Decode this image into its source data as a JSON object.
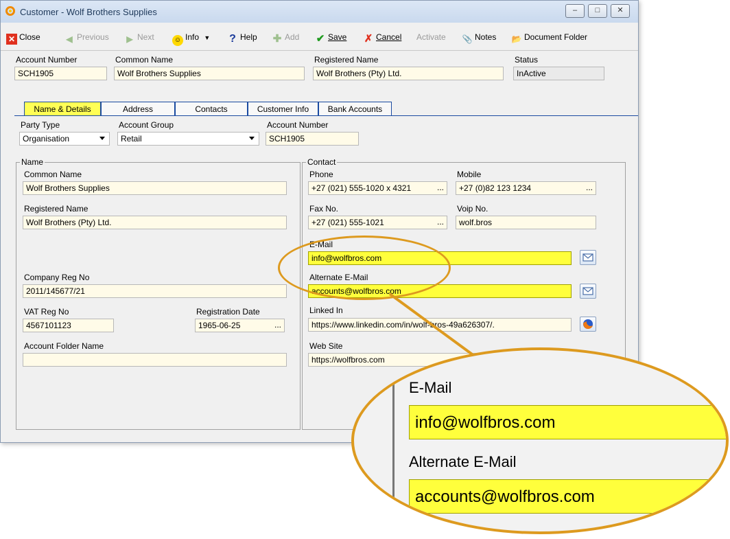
{
  "window": {
    "title": "Customer - Wolf Brothers Supplies",
    "controls": [
      "minimize",
      "maximize",
      "close"
    ]
  },
  "toolbar": {
    "close": "Close",
    "previous": "Previous",
    "next": "Next",
    "info": "Info",
    "help": "Help",
    "add": "Add",
    "save": "Save",
    "cancel": "Cancel",
    "activate": "Activate",
    "notes": "Notes",
    "document_folder": "Document Folder"
  },
  "header": {
    "account_number_label": "Account Number",
    "account_number": "SCH1905",
    "common_name_label": "Common Name",
    "common_name": "Wolf Brothers Supplies",
    "registered_name_label": "Registered Name",
    "registered_name": "Wolf Brothers (Pty) Ltd.",
    "status_label": "Status",
    "status": "InActive"
  },
  "tabs": [
    {
      "label": "Name & Details",
      "active": true
    },
    {
      "label": "Address",
      "active": false
    },
    {
      "label": "Contacts",
      "active": false
    },
    {
      "label": "Customer Info",
      "active": false
    },
    {
      "label": "Bank Accounts",
      "active": false
    }
  ],
  "details": {
    "party_type_label": "Party Type",
    "party_type": "Organisation",
    "account_group_label": "Account Group",
    "account_group": "Retail",
    "account_number_label": "Account Number",
    "account_number": "SCH1905"
  },
  "name_group": {
    "title": "Name",
    "common_name_label": "Common Name",
    "common_name": "Wolf Brothers Supplies",
    "registered_name_label": "Registered Name",
    "registered_name": "Wolf Brothers (Pty) Ltd.",
    "company_reg_label": "Company Reg No",
    "company_reg": "2011/145677/21",
    "vat_label": "VAT Reg No",
    "vat": "4567101123",
    "reg_date_label": "Registration Date",
    "reg_date": "1965-06-25",
    "folder_label": "Account Folder Name",
    "folder": ""
  },
  "contact_group": {
    "title": "Contact",
    "phone_label": "Phone",
    "phone": "+27 (021) 555-1020 x 4321",
    "mobile_label": "Mobile",
    "mobile": "+27 (0)82 123 1234",
    "fax_label": "Fax No.",
    "fax": "+27 (021) 555-1021",
    "voip_label": "Voip No.",
    "voip": "wolf.bros",
    "email_label": "E-Mail",
    "email": "info@wolfbros.com",
    "alt_email_label": "Alternate E-Mail",
    "alt_email": "accounts@wolfbros.com",
    "linkedin_label": "Linked In",
    "linkedin": "https://www.linkedin.com/in/wolf-bros-49a626307/.",
    "website_label": "Web Site",
    "website": "https://wolfbros.com"
  },
  "ellipsis": "...",
  "icons": {
    "app": "app-logo-icon",
    "email": "envelope-icon",
    "browser": "firefox-icon"
  },
  "colors": {
    "highlight_yellow": "#ffff3c",
    "field_cream": "#fffbe8",
    "callout_orange": "#dd9a1f",
    "tab_border_blue": "#1a4aa0"
  }
}
